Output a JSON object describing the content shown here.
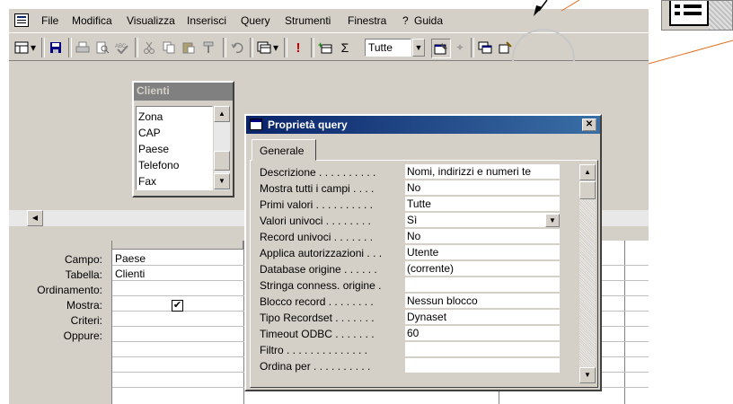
{
  "menu": {
    "items": [
      "File",
      "Modifica",
      "Visualizza",
      "Inserisci",
      "Query",
      "Strumenti",
      "Finestra",
      "?",
      "Guida"
    ]
  },
  "toolbar": {
    "combo_value": "Tutte",
    "sigma": "Σ",
    "exclaim": "!"
  },
  "table_box": {
    "title": "Clienti",
    "fields": [
      "Zona",
      "CAP",
      "Paese",
      "Telefono",
      "Fax"
    ]
  },
  "grid": {
    "row_labels": [
      "Campo:",
      "Tabella:",
      "Ordinamento:",
      "Mostra:",
      "Criteri:",
      "Oppure:"
    ],
    "col1": {
      "campo": "Paese",
      "tabella": "Clienti",
      "mostra_checked": true
    }
  },
  "dialog": {
    "title": "Proprietà query",
    "tab": "Generale",
    "close": "✕",
    "properties": [
      {
        "label": "Descrizione . . . . . . . . . .",
        "value": "Nomi, indirizzi e numeri te"
      },
      {
        "label": "Mostra tutti i campi . . . .",
        "value": "No"
      },
      {
        "label": "Primi valori . . . . . . . . . .",
        "value": "Tutte"
      },
      {
        "label": "Valori univoci . . . . . . . .",
        "value": "Sì"
      },
      {
        "label": "Record univoci . . . . . . .",
        "value": "No"
      },
      {
        "label": "Applica autorizzazioni . . .",
        "value": "Utente"
      },
      {
        "label": "Database origine . . . . . .",
        "value": "(corrente)"
      },
      {
        "label": "Stringa conness. origine .",
        "value": ""
      },
      {
        "label": "Blocco record . . . . . . . .",
        "value": "Nessun blocco"
      },
      {
        "label": "Tipo Recordset . . . . . . .",
        "value": "Dynaset"
      },
      {
        "label": "Timeout ODBC . . . . . . .",
        "value": "60"
      },
      {
        "label": "Filtro . . . . . . . . . . . . . .",
        "value": ""
      },
      {
        "label": "Ordina per . . . . . . . . . .",
        "value": ""
      }
    ]
  },
  "colors": {
    "window_bg": "#d4d0c8",
    "title_blue": "#0a246a",
    "annotation_line": "#e07020"
  }
}
